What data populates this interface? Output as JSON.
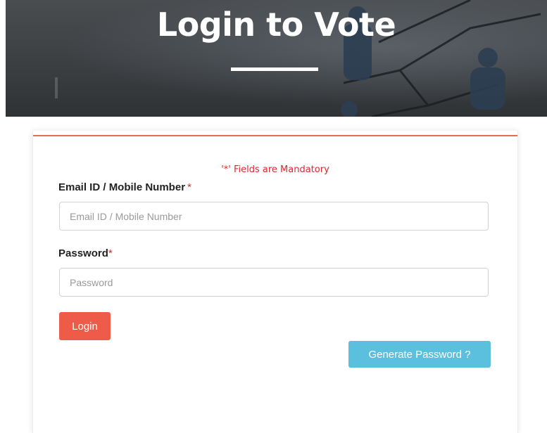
{
  "banner": {
    "title": "Login to Vote"
  },
  "form": {
    "mandatory_note": "'*' Fields are Mandatory",
    "email": {
      "label": "Email ID / Mobile Number",
      "required_mark": "*",
      "placeholder": "Email ID / Mobile Number",
      "value": ""
    },
    "password": {
      "label": "Password",
      "required_mark": "*",
      "placeholder": "Password",
      "value": ""
    },
    "login_button": "Login",
    "generate_password_button": "Generate Password ?"
  },
  "colors": {
    "accent_red": "#ef5b49",
    "required_red": "#e0262c",
    "info_blue": "#5bc0de",
    "banner_dark": "#3c3f42"
  }
}
